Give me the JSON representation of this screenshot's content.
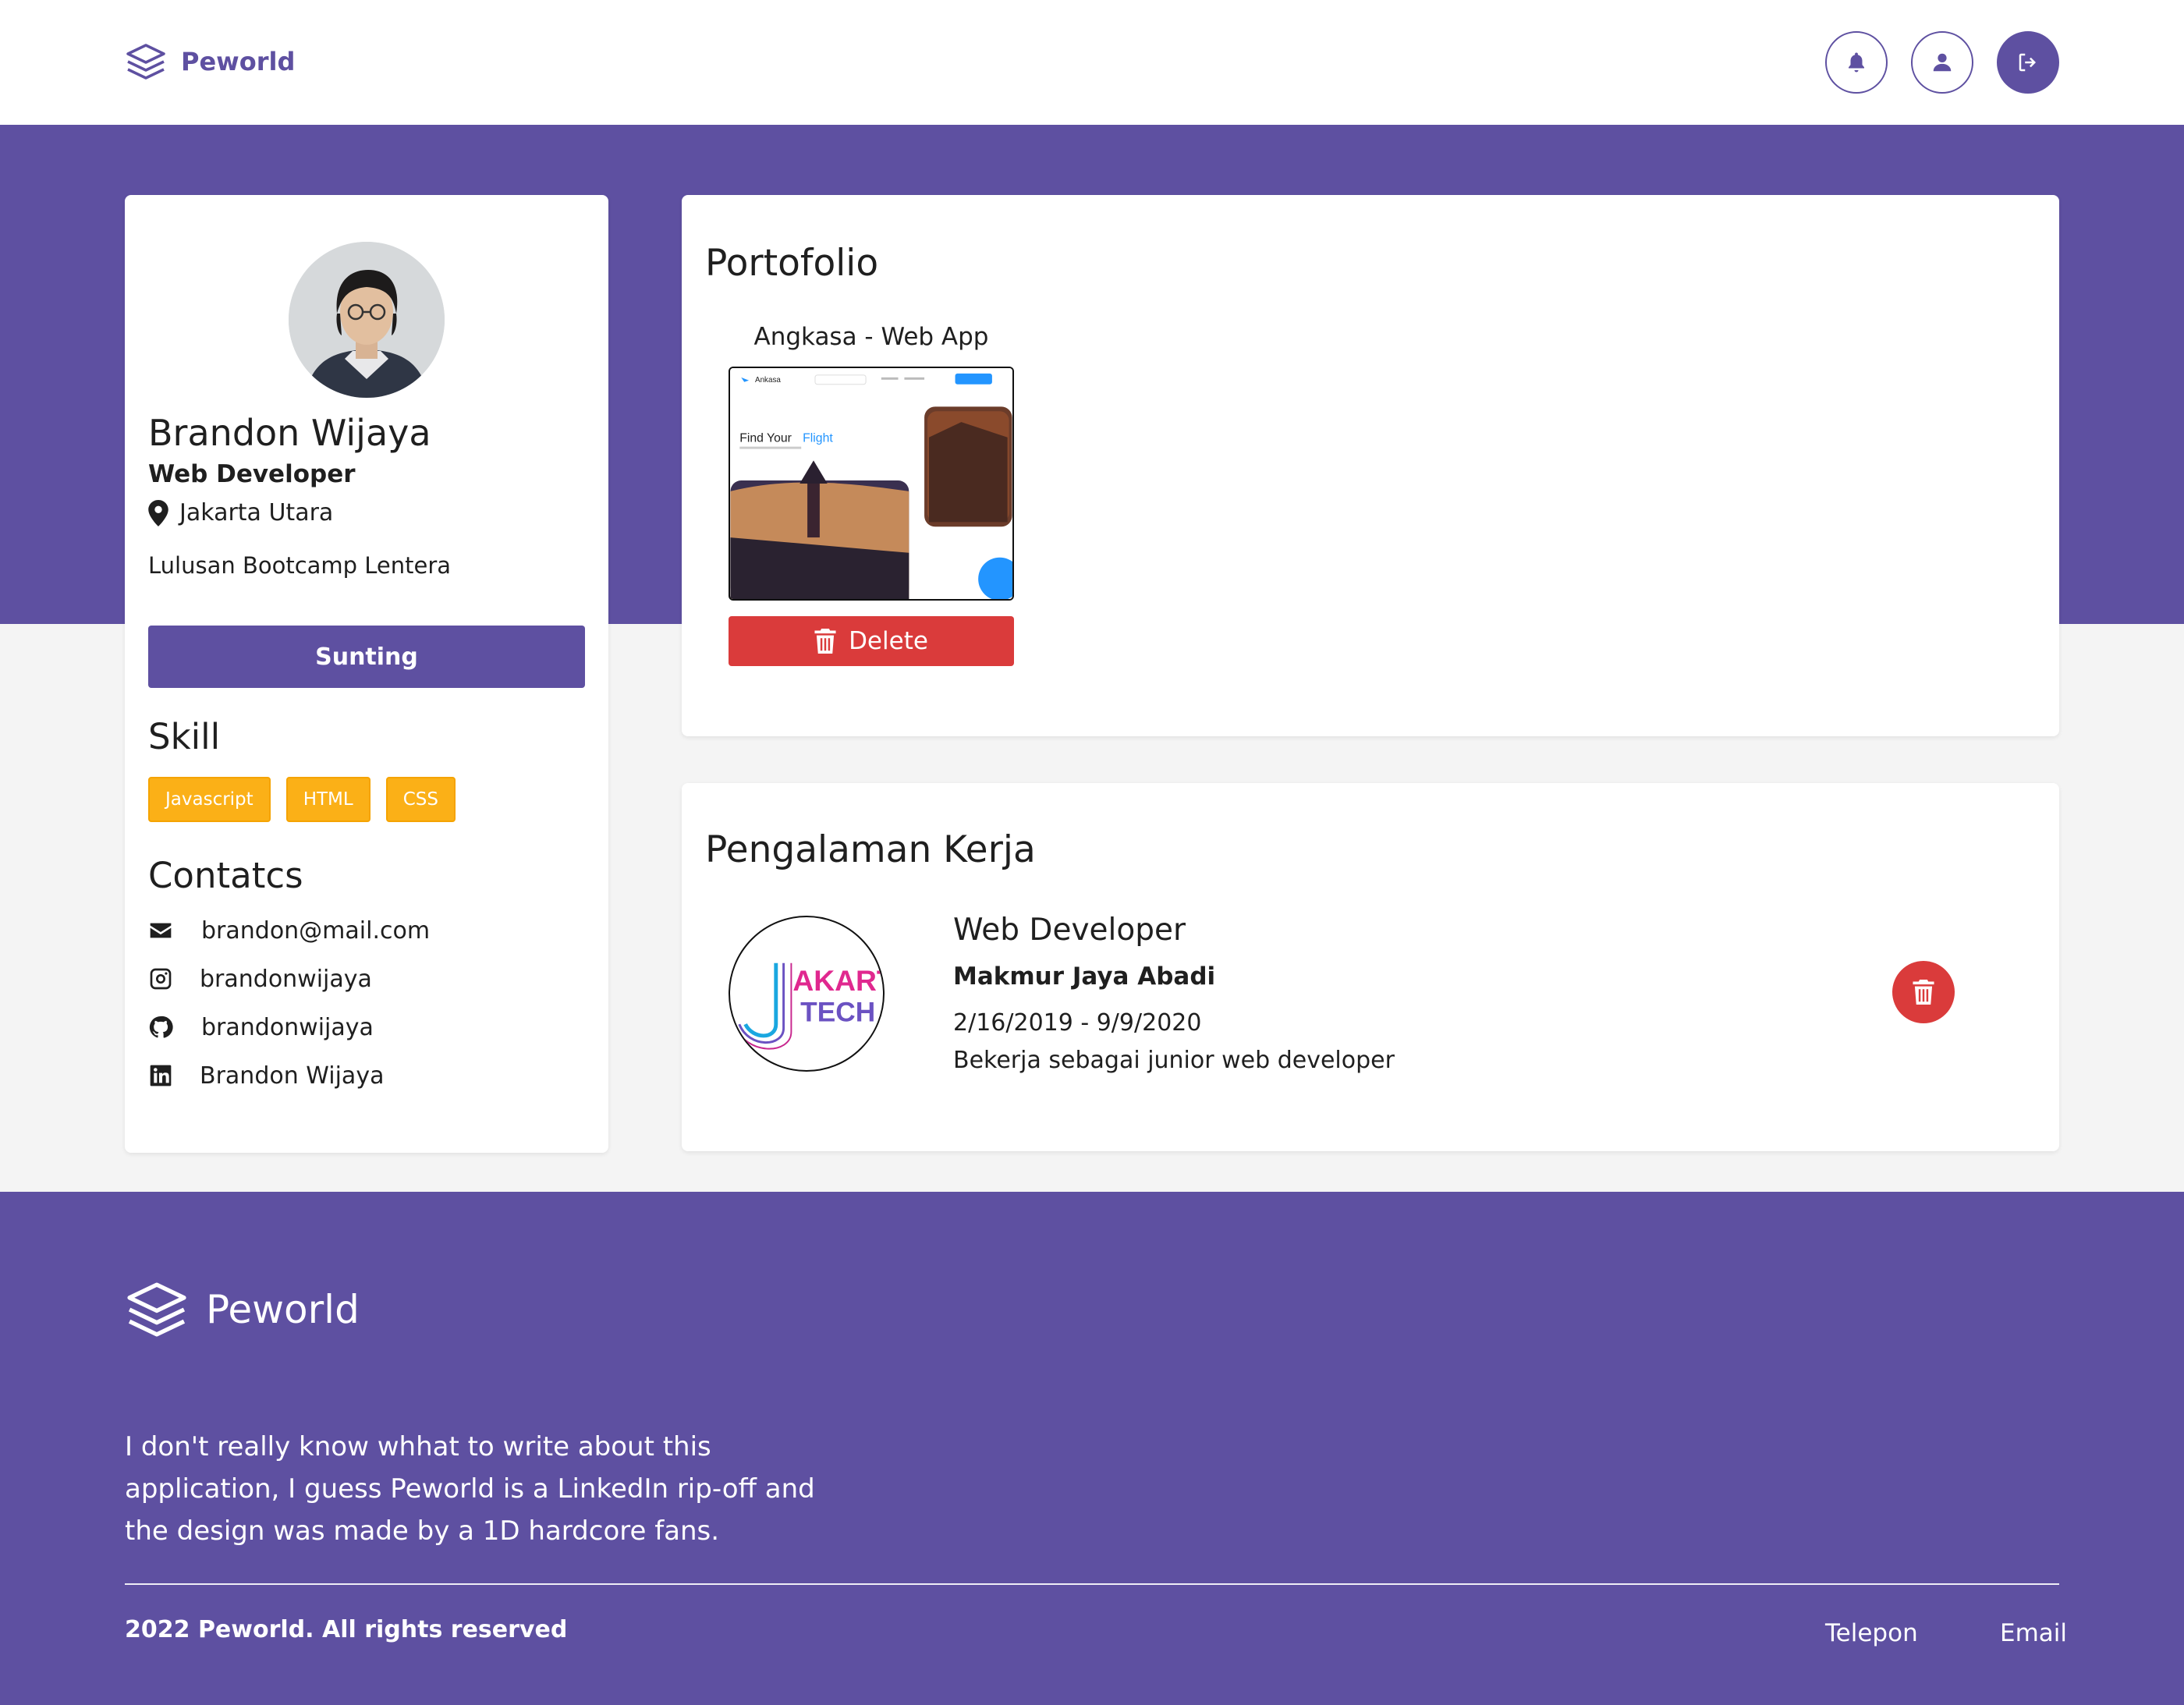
{
  "colors": {
    "primary": "#5e50a1",
    "danger": "#da3b3b",
    "skill": "#fbb017"
  },
  "header": {
    "brand": "Peworld",
    "icons": [
      "bell-icon",
      "user-icon",
      "logout-icon"
    ]
  },
  "profile": {
    "name": "Brandon Wijaya",
    "role": "Web Developer",
    "location": "Jakarta Utara",
    "description": "Lulusan Bootcamp Lentera",
    "edit_label": "Sunting",
    "skill_title": "Skill",
    "skills": [
      "Javascript",
      "HTML",
      "CSS"
    ],
    "contacts_title": "Contatcs",
    "contacts": [
      {
        "icon": "mail-icon",
        "text": "brandon@mail.com"
      },
      {
        "icon": "instagram-icon",
        "text": "brandonwijaya"
      },
      {
        "icon": "github-icon",
        "text": "brandonwijaya"
      },
      {
        "icon": "linkedin-icon",
        "text": "Brandon Wijaya"
      }
    ]
  },
  "portfolio": {
    "title": "Portofolio",
    "items": [
      {
        "title": "Angkasa - Web App",
        "delete_label": "Delete",
        "shot": {
          "app_name": "Ankasa",
          "headline": "Find Your",
          "headline_accent": "Flight"
        }
      }
    ]
  },
  "experience": {
    "title": "Pengalaman Kerja",
    "items": [
      {
        "position": "Web Developer",
        "company": "Makmur Jaya Abadi",
        "dates": "2/16/2019 - 9/9/2020",
        "description": "Bekerja sebagai junior web developer",
        "logo_text": [
          "AKARTA",
          "TECH"
        ]
      }
    ]
  },
  "footer": {
    "brand": "Peworld",
    "about": "I don't really know whhat to write about this application, I guess Peworld is a LinkedIn rip-off and the design was made by a 1D hardcore fans.",
    "copyright": "2022 Peworld. All rights reserved",
    "links": [
      "Telepon",
      "Email"
    ]
  }
}
